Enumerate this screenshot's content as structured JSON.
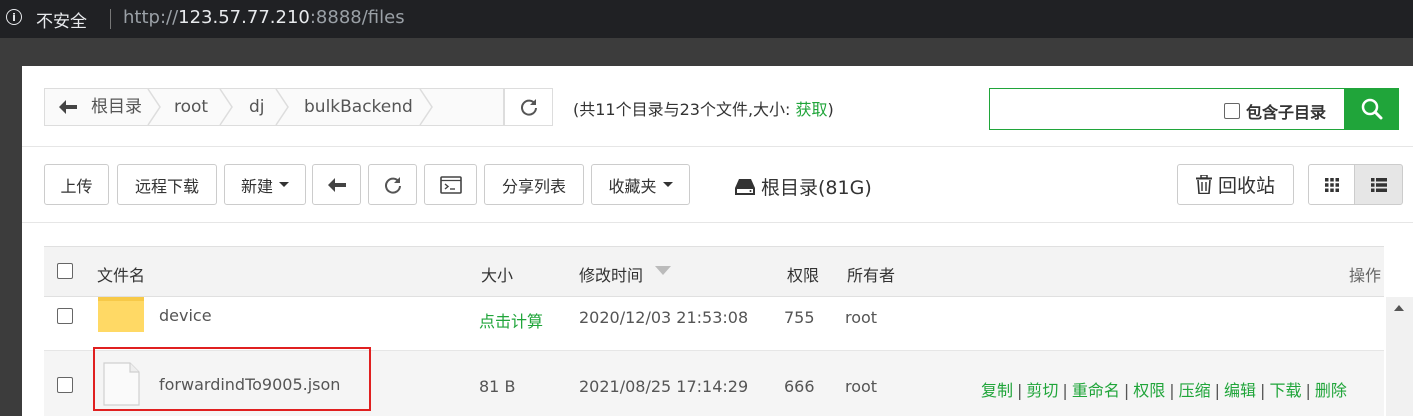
{
  "browser": {
    "security_label": "不安全",
    "url_scheme": "http://",
    "url_host": "123.57.77.210",
    "url_rest": ":8888/files"
  },
  "breadcrumb": {
    "items": [
      "根目录",
      "root",
      "dj",
      "bulkBackend"
    ]
  },
  "summary": {
    "text": "(共11个目录与23个文件,大小: ",
    "link": "获取",
    "close": ")"
  },
  "search": {
    "value": "",
    "include_subdirs_label": "包含子目录"
  },
  "toolbar": {
    "upload": "上传",
    "remote_download": "远程下载",
    "new": "新建",
    "share_list": "分享列表",
    "favorites": "收藏夹",
    "disk": "根目录(81G)",
    "recycle_bin": "回收站"
  },
  "table": {
    "headers": {
      "name": "文件名",
      "size": "大小",
      "mtime": "修改时间",
      "perm": "权限",
      "owner": "所有者",
      "ops": "操作"
    },
    "rows": [
      {
        "name": "device",
        "type": "folder",
        "size": "点击计算",
        "mtime": "2020/12/03 21:53:08",
        "perm": "755",
        "owner": "root"
      },
      {
        "name": "forwardindTo9005.json",
        "type": "file",
        "size": "81 B",
        "mtime": "2021/08/25 17:14:29",
        "perm": "666",
        "owner": "root"
      }
    ],
    "row_ops": [
      "复制",
      "剪切",
      "重命名",
      "权限",
      "压缩",
      "编辑",
      "下载",
      "删除"
    ]
  },
  "colors": {
    "accent": "#20a53a",
    "highlight": "#e02020"
  }
}
